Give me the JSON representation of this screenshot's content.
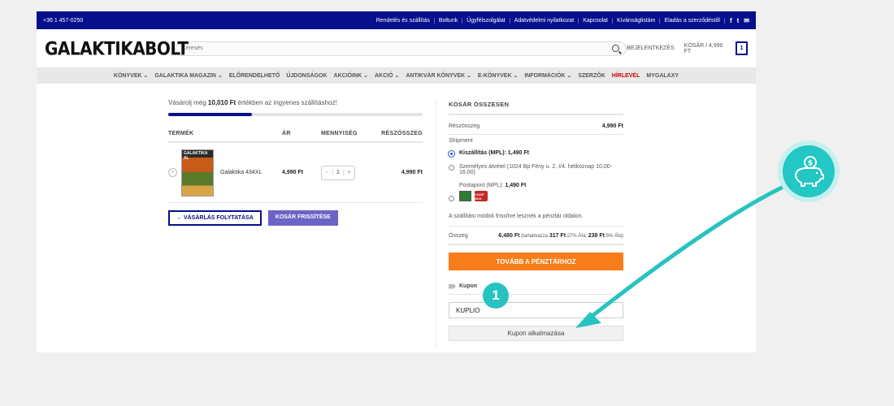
{
  "topbar": {
    "phone": "+36 1 457-0250",
    "links": [
      "Rendelés és szállítás",
      "Boltunk",
      "Ügyfélszolgálat",
      "Adatvédelmi nyilatkozat",
      "Kapcsolat",
      "Kívánságlistám",
      "Eladás a szerződéstől"
    ],
    "social": [
      "f",
      "t",
      "✉"
    ]
  },
  "header": {
    "logo": "GALAKTIKABOLT",
    "search_placeholder": "Keresés",
    "login": "BEJELENTKEZÉS",
    "cart_label": "KOSÁR / 4,990 FT",
    "cart_count": "1"
  },
  "nav": [
    "KÖNYVEK ⌄",
    "GALAKTIKA MAGAZIN ⌄",
    "ELŐRENDELHETŐ",
    "ÚJDONSÁGOK",
    "AKCIÓINK ⌄",
    "AKCIÓ ⌄",
    "ANTIKVÁR KÖNYVEK ⌄",
    "E-KÖNYVEK ⌄",
    "INFORMÁCIÓK ⌄",
    "SZERZŐK",
    "HÍRLEVÉL",
    "MYGALAXY"
  ],
  "nav_hot_index": 10,
  "cart": {
    "free_ship_prefix": "Vásárolj még",
    "free_ship_amount": "10,010 Ft",
    "free_ship_suffix": "értékben az ingyenes szállításhoz!",
    "progress": 0.33,
    "columns": [
      "TERMÉK",
      "ÁR",
      "MENNYISÉG",
      "RÉSZÖSSZEG"
    ],
    "item": {
      "cover_text": "GALAKTIKA XL",
      "name": "Galaktika 434XL",
      "price": "4,990 Ft",
      "qty_minus": "-",
      "qty": "1",
      "qty_plus": "+",
      "subtotal": "4,990 Ft",
      "remove": "×"
    },
    "continue_btn": "← VÁSÁRLÁS FOLYTATÁSA",
    "update_btn": "KOSÁR FRISSÍTÉSE"
  },
  "summary": {
    "title": "KOSÁR ÖSSZESEN",
    "subtotal_label": "Részösszeg",
    "subtotal_value": "4,990 Ft",
    "shipment_label": "Shipment",
    "opt1_label": "Kiszállítás (MPL):",
    "opt1_price": "1,490 Ft",
    "opt2_label": "Személyes átvétel (1024 Bp Fény u. 2. I/4. hétköznap 10.00-16.00)",
    "opt3_label": "Postapont (MPL):",
    "opt3_price": "1,490 Ft",
    "coop_text": "COOP BOX",
    "note": "A szállítási módok frissítve lesznek a pénztár oldalon.",
    "total_label": "Összeg",
    "total_value": "6,480 Ft",
    "tax_pre": "(tartalmazza",
    "tax1": "317 Ft",
    "tax1_text": "27% Áfa,",
    "tax2": "238 Ft",
    "tax2_text": "5% Áfa)",
    "checkout_btn": "TOVÁBB A PÉNZTÁRHOZ",
    "coupon_label": "Kupon",
    "coupon_value": "KUPLIO",
    "apply_btn": "Kupon alkalmazása"
  },
  "overlay": {
    "step_number": "1",
    "accent": "#27c3c0"
  }
}
